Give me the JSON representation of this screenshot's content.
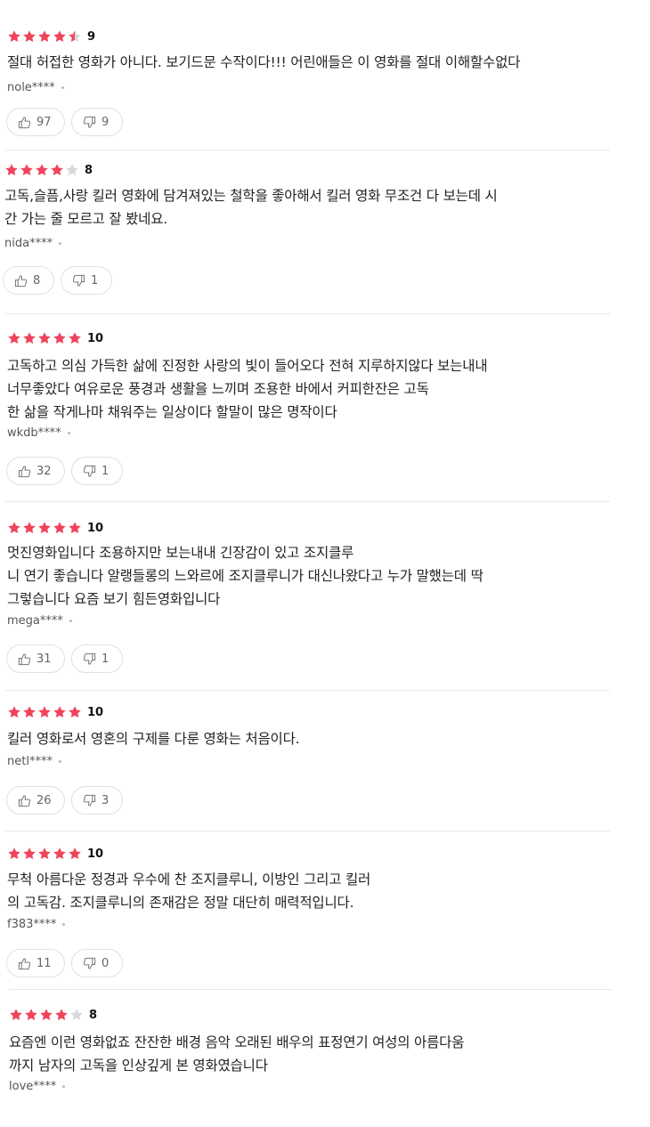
{
  "colors": {
    "star_filled": "#f0445b",
    "star_empty": "#d9d9d9"
  },
  "reviews": [
    {
      "rating_stars": 4.5,
      "score": "9",
      "content": "절대 허접한 영화가 아니다.  보기드문 수작이다!!!  어린애들은 이 영화를 절대 이해할수없다",
      "user": "nole****",
      "likes": "97",
      "dislikes": "9"
    },
    {
      "rating_stars": 4,
      "score": "8",
      "content": "고독,슬픔,사랑 킬러 영화에 담겨져있는 철학을 좋아해서 킬러 영화 무조건 다 보는데 시\n간 가는 줄 모르고 잘 봤네요.",
      "user": "nida****",
      "likes": "8",
      "dislikes": "1"
    },
    {
      "rating_stars": 5,
      "score": "10",
      "content": "고독하고 의심 가득한 삶에 진정한 사랑의 빛이 들어오다 전혀 지루하지않다 보는내내\n너무좋았다 여유로운 풍경과 생활을 느끼며 조용한 바에서 커피한잔은 고독\n한 삶을 작게나마 채워주는 일상이다 할말이 많은 명작이다",
      "user": "wkdb****",
      "likes": "32",
      "dislikes": "1"
    },
    {
      "rating_stars": 5,
      "score": "10",
      "content": "멋진영화입니다  조용하지만 보는내내 긴장감이 있고 조지클루\n니 연기 좋습니다 알랭들롱의 느와르에 조지클루니가 대신나왔다고 누가 말했는데 딱\n그렇습니다 요즘 보기 힘든영화입니다",
      "user": "mega****",
      "likes": "31",
      "dislikes": "1"
    },
    {
      "rating_stars": 5,
      "score": "10",
      "content": "킬러 영화로서 영혼의 구제를 다룬 영화는 처음이다.",
      "user": "netl****",
      "likes": "26",
      "dislikes": "3"
    },
    {
      "rating_stars": 5,
      "score": "10",
      "content": "무척 아름다운  정경과 우수에 찬 조지클루니, 이방인  그리고 킬러\n의 고독감. 조지클루니의 존재감은 정말 대단히 매력적입니다.",
      "user": "f383****",
      "likes": "11",
      "dislikes": "0"
    },
    {
      "rating_stars": 4,
      "score": "8",
      "content": "요즘엔 이런 영화없죠 잔잔한 배경 음악 오래된 배우의 표정연기 여성의 아름다움\n까지 남자의 고독을 인상깊게 본 영화였습니다",
      "user": "love****",
      "likes": "",
      "dislikes": ""
    }
  ]
}
